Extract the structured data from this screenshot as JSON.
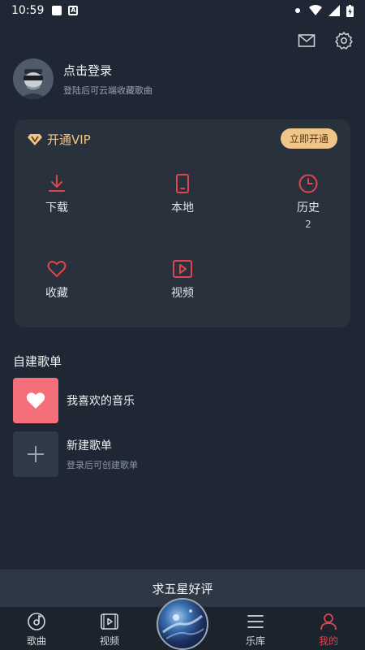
{
  "status": {
    "time": "10:59"
  },
  "header": {
    "mail_icon": "mail-icon",
    "settings_icon": "gear-icon"
  },
  "profile": {
    "title": "点击登录",
    "subtitle": "登陆后可云端收藏歌曲"
  },
  "vip": {
    "label": "开通VIP",
    "button": "立即开通",
    "accent": "#f0c58a"
  },
  "grid": [
    {
      "label": "下载",
      "icon": "download-icon"
    },
    {
      "label": "本地",
      "icon": "phone-icon"
    },
    {
      "label": "历史",
      "icon": "clock-icon",
      "count": "2"
    },
    {
      "label": "收藏",
      "icon": "heart-icon"
    },
    {
      "label": "视频",
      "icon": "video-icon"
    }
  ],
  "playlists": {
    "section_title": "自建歌单",
    "liked": {
      "title": "我喜欢的音乐",
      "color": "#f56f7a"
    },
    "create": {
      "title": "新建歌单",
      "subtitle": "登录后可创建歌单"
    }
  },
  "rate_bar": {
    "text": "求五星好评"
  },
  "nav": {
    "items": [
      {
        "label": "歌曲",
        "icon": "disc-icon"
      },
      {
        "label": "视频",
        "icon": "video-icon"
      },
      {
        "label": "乐库",
        "icon": "menu-icon"
      },
      {
        "label": "我的",
        "icon": "user-icon",
        "active": true
      }
    ],
    "active_color": "#e0454f",
    "inactive_color": "#d4d9de"
  }
}
